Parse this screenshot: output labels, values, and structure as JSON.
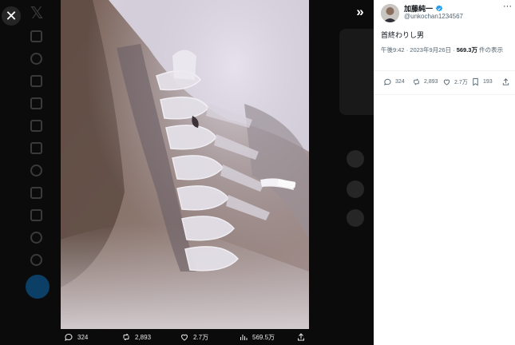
{
  "modal": {
    "close_icon": "close-icon",
    "expand_icon": "double-chevron-right-icon"
  },
  "media_actions": {
    "replies": "324",
    "reposts": "2,893",
    "likes": "2.7万",
    "views": "569.5万"
  },
  "tweet": {
    "author_name": "加藤純一",
    "author_handle": "@unkochan1234567",
    "text": "首終わりし男",
    "time": "午後9:42",
    "date": "2023年9月26日",
    "views_count": "569.3万",
    "views_suffix": " 件の表示",
    "stats": {
      "replies": "324",
      "reposts": "2,893",
      "likes": "2.7万",
      "bookmarks": "193"
    }
  },
  "colors": {
    "accent": "#1d9bf0",
    "text_primary": "#0f1419",
    "text_secondary": "#536471"
  }
}
